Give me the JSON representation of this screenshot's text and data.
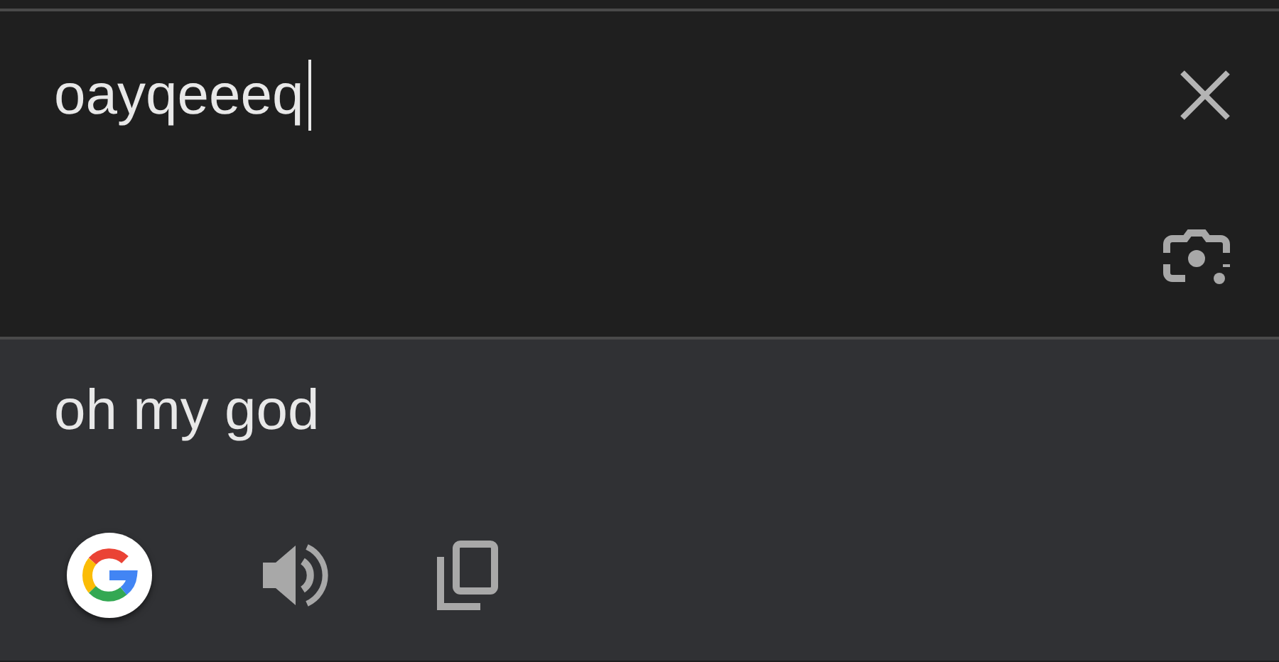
{
  "source": {
    "value": "oayqeeeq",
    "focused": true
  },
  "translation": {
    "text": "oh my god"
  }
}
